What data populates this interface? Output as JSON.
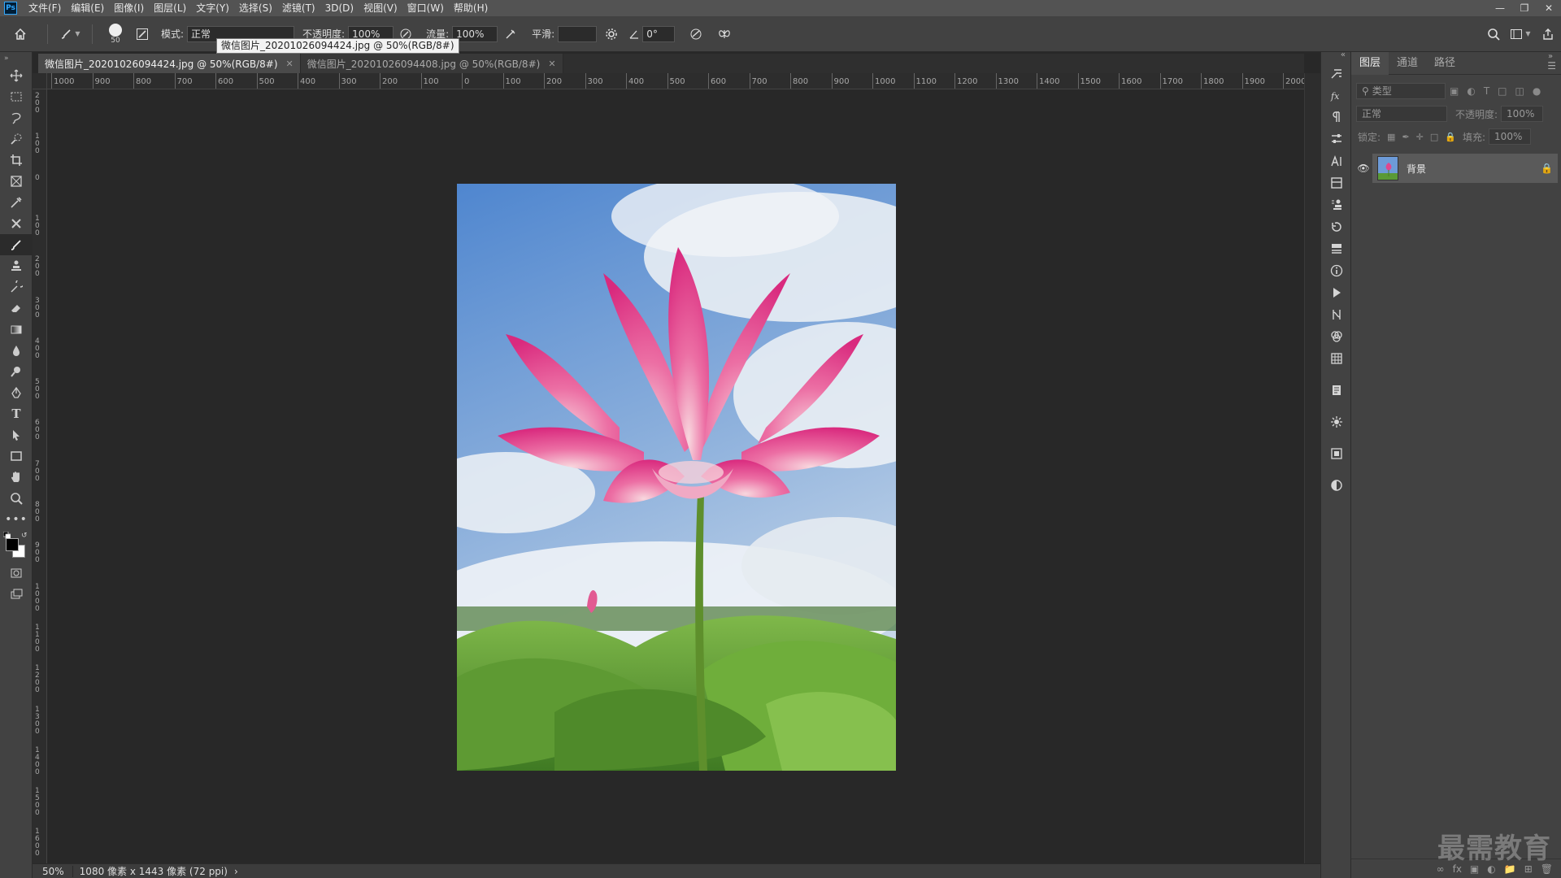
{
  "app": {
    "logo": "Ps"
  },
  "menu": [
    "文件(F)",
    "编辑(E)",
    "图像(I)",
    "图层(L)",
    "文字(Y)",
    "选择(S)",
    "滤镜(T)",
    "3D(D)",
    "视图(V)",
    "窗口(W)",
    "帮助(H)"
  ],
  "options": {
    "brush_size": "50",
    "mode_label": "模式:",
    "mode_value": "正常",
    "opacity_label": "不透明度:",
    "opacity_value": "100%",
    "flow_label": "流量:",
    "flow_value": "100%",
    "smoothing_label": "平滑:",
    "smoothing_value": "",
    "angle_value": "0°"
  },
  "tooltip": "微信图片_20201026094424.jpg @ 50%(RGB/8#)",
  "tabs": [
    {
      "label": "微信图片_20201026094424.jpg @ 50%(RGB/8#)",
      "active": true
    },
    {
      "label": "微信图片_20201026094408.jpg @ 50%(RGB/8#)",
      "active": false
    }
  ],
  "ruler_top": [
    "1000",
    "900",
    "800",
    "700",
    "600",
    "500",
    "400",
    "300",
    "200",
    "100",
    "0",
    "100",
    "200",
    "300",
    "400",
    "500",
    "600",
    "700",
    "800",
    "900",
    "1000",
    "1100",
    "1200",
    "1300",
    "1400",
    "1500",
    "1600",
    "1700",
    "1800",
    "1900",
    "2000"
  ],
  "ruler_left": [
    "200",
    "100",
    "0",
    "100",
    "200",
    "300",
    "400",
    "500",
    "600",
    "700",
    "800",
    "900",
    "1000",
    "1100",
    "1200",
    "1300",
    "1400",
    "1500",
    "1600"
  ],
  "status": {
    "zoom": "50%",
    "doc_info": "1080 像素 x 1443 像素 (72 ppi)",
    "arrow": "›"
  },
  "layers_panel": {
    "tabs": [
      "图层",
      "通道",
      "路径"
    ],
    "filter_placeholder": "类型",
    "blend_mode": "正常",
    "opacity_label": "不透明度:",
    "opacity_value": "100%",
    "lock_label": "锁定:",
    "fill_label": "填充:",
    "fill_value": "100%",
    "layers": [
      {
        "name": "背景",
        "visible": true,
        "locked": true
      }
    ]
  },
  "watermark": "最需教育",
  "colors": {
    "accent": "#31a8ff",
    "foreground": "#000000",
    "background": "#ffffff"
  }
}
